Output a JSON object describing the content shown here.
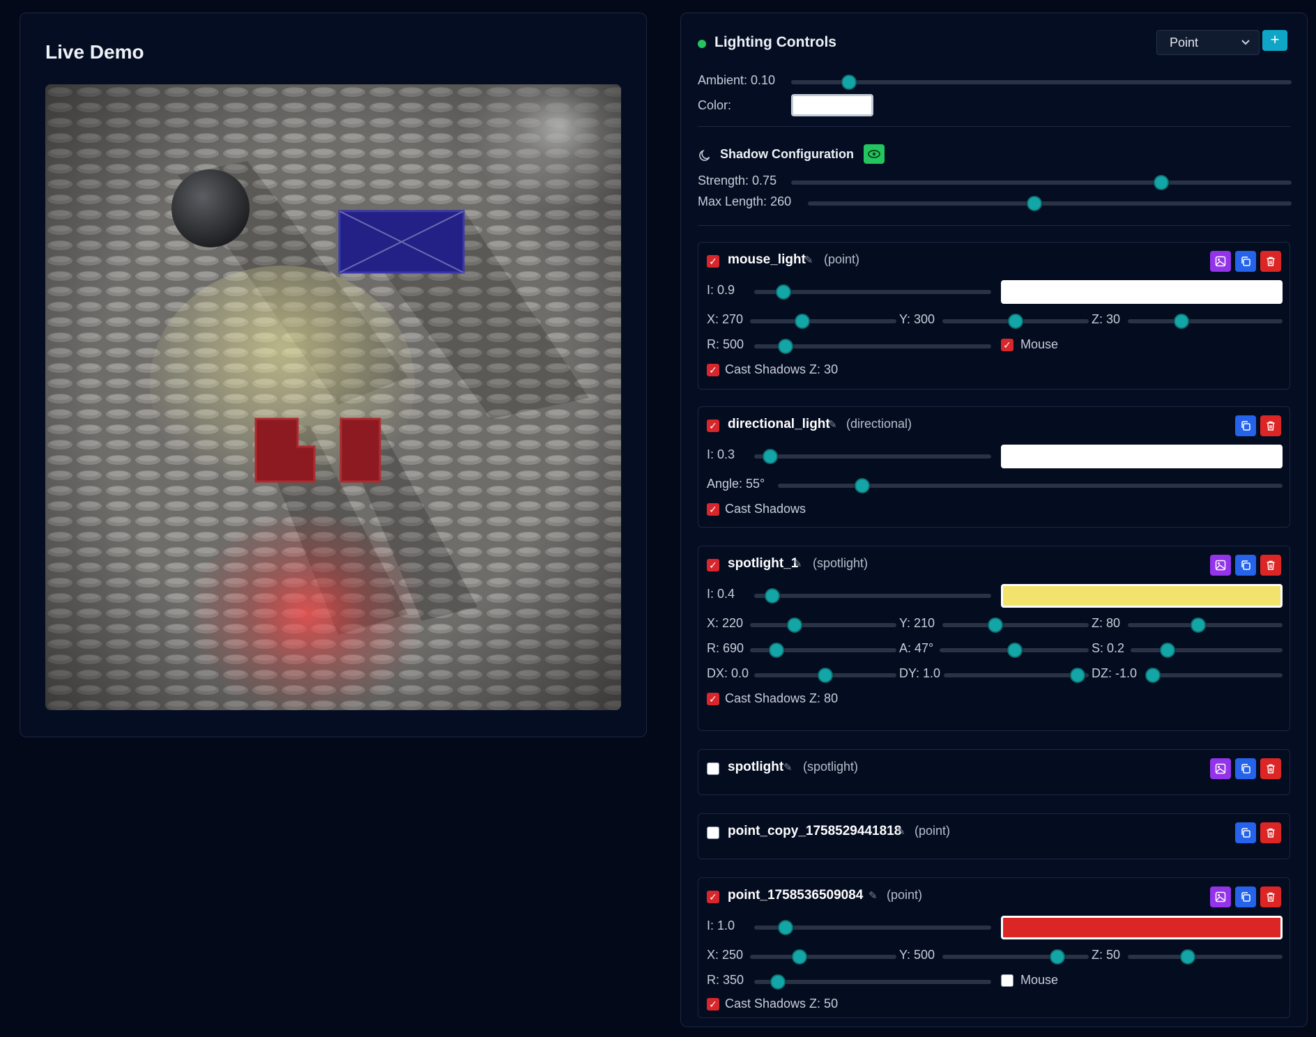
{
  "demo": {
    "title": "Live Demo"
  },
  "header": {
    "title": "Lighting Controls",
    "type_select": "Point",
    "add_label": "+"
  },
  "ambient": {
    "label": "Ambient: 0.10",
    "value": 0.1,
    "color_label": "Color:",
    "color": "#ffffff"
  },
  "shadow": {
    "title": "Shadow Configuration",
    "strength_label": "Strength: 0.75",
    "strength": 0.75,
    "max_length_label": "Max Length: 260",
    "max_length": 260
  },
  "lights": {
    "mouse": {
      "name": "mouse_light",
      "type": "(point)",
      "enabled": true,
      "color": "#ffffff",
      "i_label": "I: 0.9",
      "x_label": "X: 270",
      "y_label": "Y: 300",
      "z_label": "Z: 30",
      "r_label": "R: 500",
      "mouse_label": "Mouse",
      "cast_label": "Cast Shadows Z: 30"
    },
    "directional": {
      "name": "directional_light",
      "type": "(directional)",
      "enabled": true,
      "color": "#ffffff",
      "i_label": "I: 0.3",
      "angle_label": "Angle: 55°",
      "cast_label": "Cast Shadows"
    },
    "spot1": {
      "name": "spotlight_1",
      "type": "(spotlight)",
      "enabled": true,
      "color": "#f2e36d",
      "i_label": "I: 0.4",
      "x_label": "X: 220",
      "y_label": "Y: 210",
      "z_label": "Z: 80",
      "r_label": "R: 690",
      "a_label": "A: 47°",
      "s_label": "S: 0.2",
      "dx_label": "DX: 0.0",
      "dy_label": "DY: 1.0",
      "dz_label": "DZ: -1.0",
      "cast_label": "Cast Shadows Z: 80"
    },
    "spot": {
      "name": "spotlight",
      "type": "(spotlight)",
      "enabled": false
    },
    "point_copy": {
      "name": "point_copy_1758529441818",
      "type": "(point)",
      "enabled": false
    },
    "point": {
      "name": "point_1758536509084",
      "type": "(point)",
      "enabled": true,
      "color": "#dc2626",
      "i_label": "I: 1.0",
      "x_label": "X: 250",
      "y_label": "Y: 500",
      "z_label": "Z: 50",
      "r_label": "R: 350",
      "mouse_label": "Mouse",
      "cast_label": "Cast Shadows Z: 50"
    }
  },
  "icons": {
    "status": "status-dot-icon",
    "moon": "moon-icon",
    "eye": "eye-icon",
    "image": "image-icon",
    "copy": "copy-icon",
    "trash": "trash-icon",
    "pencil": "pencil-icon",
    "chevron": "chevron-down-icon"
  }
}
